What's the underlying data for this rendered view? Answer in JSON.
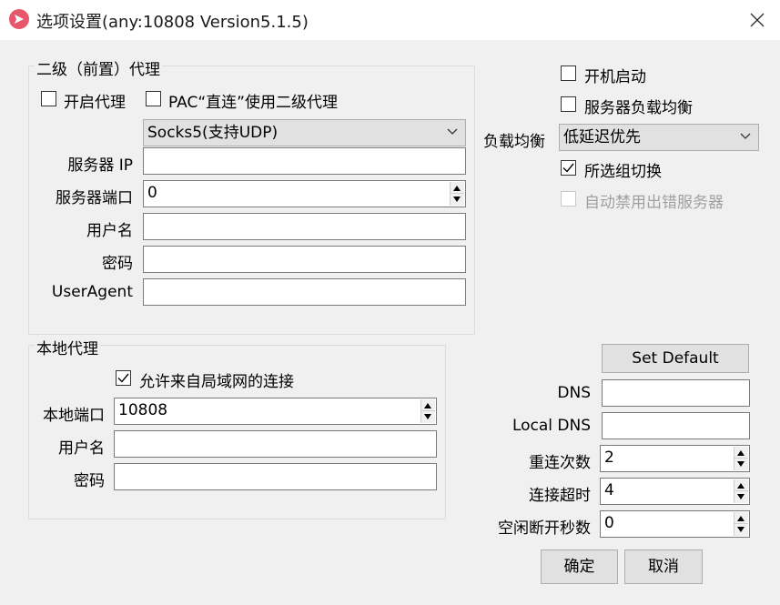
{
  "window": {
    "title": "选项设置(any:10808 Version5.1.5)"
  },
  "secondary_proxy": {
    "group_title": "二级（前置）代理",
    "enable_label": "开启代理",
    "enable_checked": false,
    "pac_label": "PAC“直连”使用二级代理",
    "pac_checked": false,
    "proxy_type": "Socks5(支持UDP)",
    "server_ip_label": "服务器 IP",
    "server_ip_value": "",
    "server_port_label": "服务器端口",
    "server_port_value": "0",
    "username_label": "用户名",
    "username_value": "",
    "password_label": "密码",
    "password_value": "",
    "useragent_label": "UserAgent",
    "useragent_value": ""
  },
  "local_proxy": {
    "group_title": "本地代理",
    "allow_lan_label": "允许来自局域网的连接",
    "allow_lan_checked": true,
    "port_label": "本地端口",
    "port_value": "10808",
    "username_label": "用户名",
    "username_value": "",
    "password_label": "密码",
    "password_value": ""
  },
  "startup": {
    "autostart_label": "开机启动",
    "autostart_checked": false,
    "load_balance_label": "服务器负载均衡",
    "load_balance_checked": false,
    "balance_strategy_label": "负载均衡",
    "balance_strategy_value": "低延迟优先",
    "switch_group_label": "所选组切换",
    "switch_group_checked": true,
    "auto_disable_label": "自动禁用出错服务器",
    "auto_disable_checked": false
  },
  "network": {
    "set_default_label": "Set Default",
    "dns_label": "DNS",
    "dns_value": "",
    "local_dns_label": "Local DNS",
    "local_dns_value": "",
    "reconnect_label": "重连次数",
    "reconnect_value": "2",
    "timeout_label": "连接超时",
    "timeout_value": "4",
    "idle_label": "空闲断开秒数",
    "idle_value": "0"
  },
  "buttons": {
    "ok_label": "确定",
    "cancel_label": "取消"
  },
  "colors": {
    "app_icon": "#e8566c",
    "background": "#f0f0f0",
    "titlebar": "#ffffff"
  }
}
